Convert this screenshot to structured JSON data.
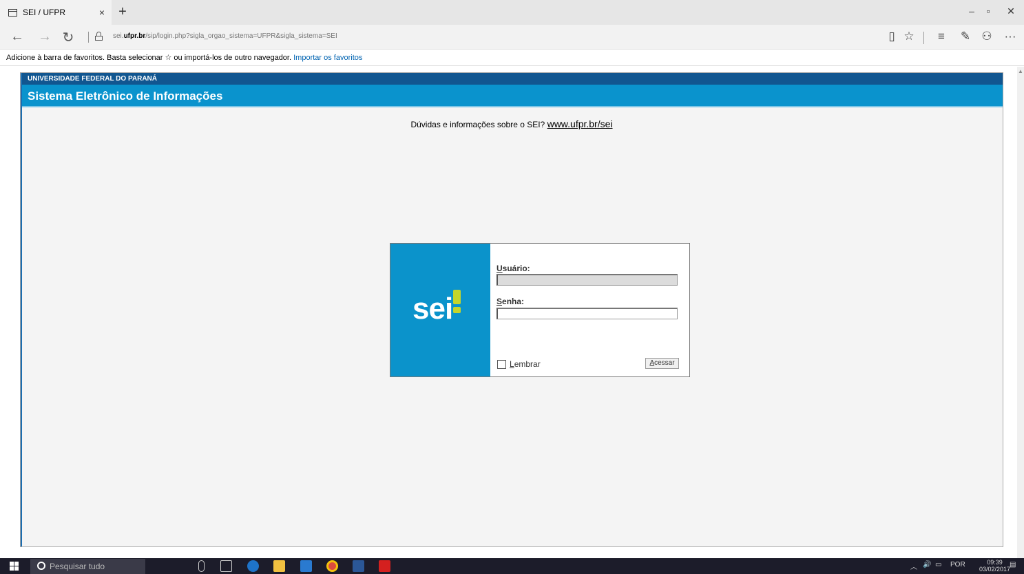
{
  "tab": {
    "title": "SEI / UFPR",
    "close": "×",
    "new_tab": "+"
  },
  "window": {
    "minimize": "–",
    "restore": "▫",
    "close": "✕"
  },
  "address": {
    "url_prefix": "sei.",
    "url_domain": "ufpr.br",
    "url_path": "/sip/login.php?sigla_orgao_sistema=UFPR&sigla_sistema=SEI"
  },
  "nav": {
    "back": "←",
    "forward": "→",
    "refresh": "↻"
  },
  "toolbar": {
    "reading": "▯",
    "favorite": "☆",
    "hub": "≡",
    "note": "✎",
    "share": "⚇",
    "more": "···"
  },
  "favbar": {
    "text": "Adicione à barra de favoritos. Basta selecionar ☆ ou importá-los de outro navegador.",
    "link": "Importar os favoritos"
  },
  "header": {
    "org": "UNIVERSIDADE FEDERAL DO PARANÁ",
    "system": "Sistema Eletrônico de Informações"
  },
  "info": {
    "text": "Dúvidas e informações sobre o SEI?",
    "link": "www.ufpr.br/sei"
  },
  "login": {
    "logo": "sei",
    "user_label_first": "U",
    "user_label_rest": "suário:",
    "user_value": "",
    "pass_label_first": "S",
    "pass_label_rest": "enha:",
    "pass_value": "",
    "remember_first": "L",
    "remember_rest": "embrar",
    "submit_first": "A",
    "submit_rest": "cessar"
  },
  "taskbar": {
    "search_placeholder": "Pesquisar tudo",
    "language": "POR",
    "time": "09:39",
    "date": "03/02/2017"
  },
  "colors": {
    "header_dark": "#115690",
    "header_light": "#0a93cd",
    "logo_accent": "#c5d52a",
    "link": "#0063b1"
  },
  "icons": [
    "tab-page-icon",
    "back-arrow-icon",
    "forward-arrow-icon",
    "refresh-icon",
    "lock-icon",
    "reading-view-icon",
    "favorite-star-icon",
    "hub-icon",
    "web-note-icon",
    "share-icon",
    "more-icon",
    "windows-start-icon",
    "search-circle-icon",
    "task-view-icon",
    "edge-icon",
    "explorer-icon",
    "store-icon",
    "chrome-icon",
    "word-icon",
    "acrobat-icon"
  ]
}
